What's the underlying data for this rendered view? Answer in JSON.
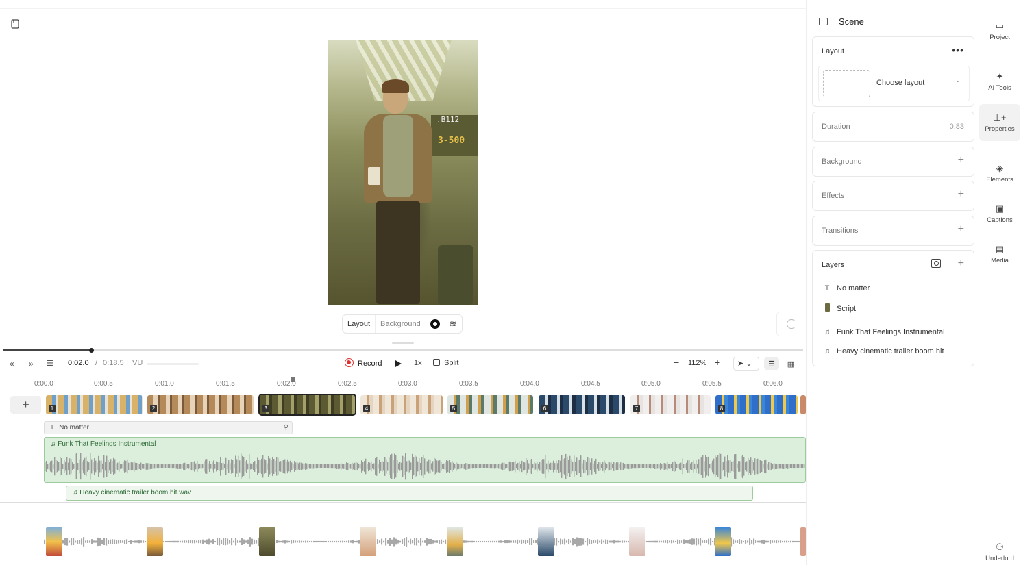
{
  "preview": {
    "sign_top": ".B112",
    "sign_main": "3-500",
    "toolbar": {
      "layout": "Layout",
      "background": "Background"
    }
  },
  "transport": {
    "current_time": "0:02.0",
    "separator": "/",
    "total_time": "0:18.5",
    "vu": "VU",
    "record": "Record",
    "speed": "1x",
    "split": "Split",
    "zoom": "112%"
  },
  "ruler": {
    "ticks": [
      "0:00.0",
      "0:00.5",
      "0:01.0",
      "0:01.5",
      "0:02.0",
      "0:02.5",
      "0:03.0",
      "0:03.5",
      "0:04.0",
      "0:04.5",
      "0:05.0",
      "0:05.5",
      "0:06.0"
    ]
  },
  "scenes": {
    "numbers": [
      "1",
      "2",
      "3",
      "4",
      "5",
      "6",
      "7",
      "8"
    ]
  },
  "tracks": {
    "text_track": "No matter",
    "audio1": "Funk That Feelings Instrumental",
    "audio2": "Heavy cinematic trailer boom hit.wav"
  },
  "panel": {
    "title": "Scene",
    "layout": {
      "title": "Layout",
      "choose": "Choose layout"
    },
    "duration": {
      "title": "Duration",
      "value": "0.83"
    },
    "background": "Background",
    "effects": "Effects",
    "transitions": "Transitions",
    "layers": {
      "title": "Layers",
      "items": [
        "No matter",
        "Script",
        "Funk That Feelings Instrumental",
        "Heavy cinematic trailer boom hit"
      ]
    }
  },
  "nav": {
    "items": [
      "Project",
      "AI Tools",
      "Properties",
      "Elements",
      "Captions",
      "Media",
      "Underlord"
    ],
    "active": "Properties"
  },
  "colors": {
    "audio_green": "#dcefdc",
    "record_red": "#d33333",
    "accent_dark": "#222222"
  }
}
